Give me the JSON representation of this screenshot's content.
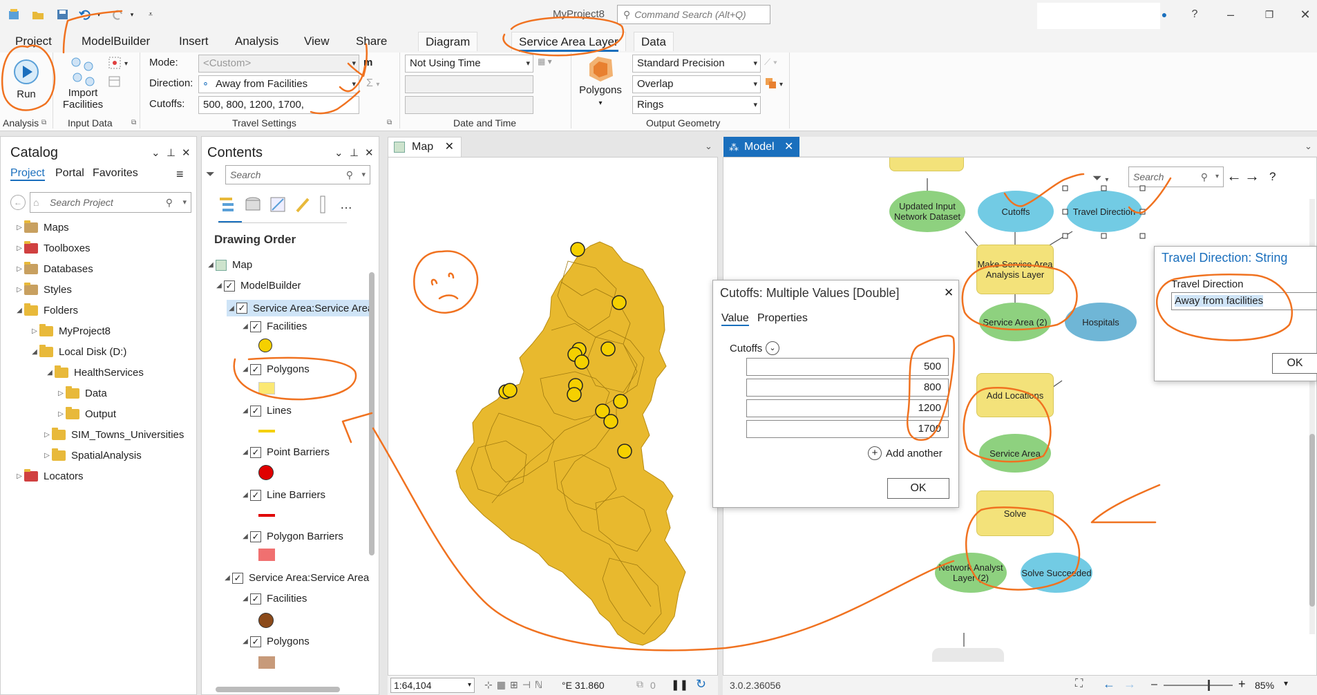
{
  "app": {
    "title": "MyProject8",
    "command_search_placeholder": "Command Search (Alt+Q)"
  },
  "ribbon_tabs": [
    "Project",
    "ModelBuilder",
    "Insert",
    "Analysis",
    "View",
    "Share",
    "Diagram",
    "Service Area Layer",
    "Data"
  ],
  "ribbon": {
    "run_label": "Run",
    "import_facilities_label": "Import Facilities",
    "mode_label": "Mode:",
    "mode_value": "<Custom>",
    "direction_label": "Direction:",
    "direction_value": "Away from Facilities",
    "cutoffs_label": "Cutoffs:",
    "cutoffs_value": "500, 800, 1200, 1700,",
    "time_value": "Not Using Time",
    "polygons_label": "Polygons",
    "precision_value": "Standard Precision",
    "overlap_value": "Overlap",
    "rings_value": "Rings",
    "groups": [
      "Analysis",
      "Input Data",
      "Travel Settings",
      "Date and Time",
      "Output Geometry"
    ]
  },
  "catalog": {
    "title": "Catalog",
    "tabs": [
      "Project",
      "Portal",
      "Favorites"
    ],
    "search_placeholder": "Search Project",
    "items": [
      "Maps",
      "Toolboxes",
      "Databases",
      "Styles",
      "Folders",
      "MyProject8",
      "Local Disk (D:)",
      "HealthServices",
      "Data",
      "Output",
      "SIM_Towns_Universities",
      "SpatialAnalysis",
      "Locators"
    ]
  },
  "contents": {
    "title": "Contents",
    "search_placeholder": "Search",
    "drawing_order": "Drawing Order",
    "map": "Map",
    "modelbuilder": "ModelBuilder",
    "layer1": "Service Area:Service Area",
    "layer1_sub": [
      "Facilities",
      "Polygons",
      "Lines",
      "Point Barriers",
      "Line Barriers",
      "Polygon Barriers"
    ],
    "layer2": "Service Area:Service Area",
    "layer2_sub": [
      "Facilities",
      "Polygons"
    ]
  },
  "map_view": {
    "tab": "Map",
    "scale": "1:64,104",
    "coords": "°E 31.860",
    "count": "0"
  },
  "model_view": {
    "tab": "Model",
    "search_placeholder": "Search",
    "nodes": {
      "updated_input": "Updated Input Network Dataset",
      "cutoffs": "Cutoffs",
      "travel_direction": "Travel Direction",
      "make_sa": "Make Service Area Analysis Layer",
      "service_area_2": "Service Area (2)",
      "hospitals": "Hospitals",
      "add_locations": "Add Locations",
      "service_area": "Service Area",
      "solve": "Solve",
      "na_layer_2": "Network Analyst Layer (2)",
      "solve_succeeded": "Solve Succeeded"
    },
    "version": "3.0.2.36056",
    "zoom": "85%"
  },
  "cutoffs_dialog": {
    "title": "Cutoffs: Multiple Values [Double]",
    "tabs": [
      "Value",
      "Properties"
    ],
    "label": "Cutoffs",
    "values": [
      "500",
      "800",
      "1200",
      "1700"
    ],
    "add_another": "Add another",
    "ok": "OK"
  },
  "travel_dialog": {
    "title": "Travel Direction: String",
    "label": "Travel Direction",
    "value": "Away from facilities",
    "ok": "OK"
  },
  "colors": {
    "accent": "#1a6fbd",
    "annotation": "#f07220",
    "polygon_fill": "#e8b92e",
    "facility": "#f5d000"
  }
}
